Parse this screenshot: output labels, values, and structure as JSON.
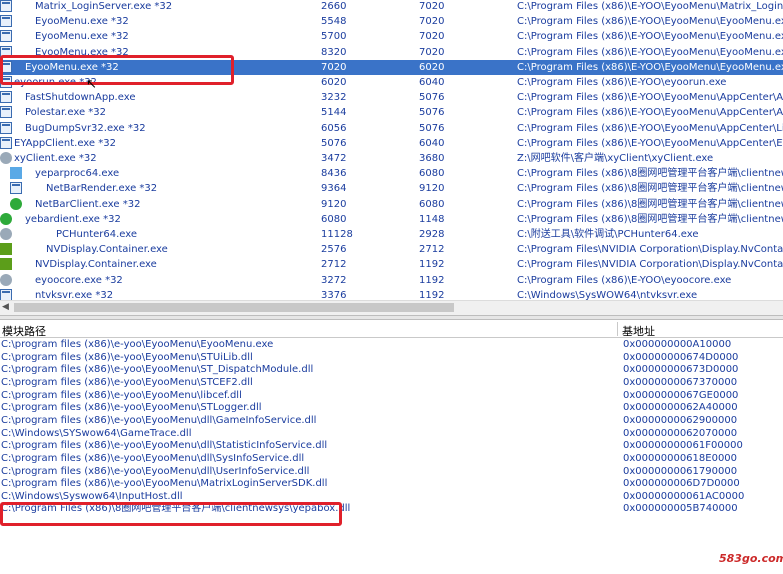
{
  "processes": [
    {
      "name": "Matrix_LoginServer.exe *32",
      "pid": "2660",
      "ppid": "7020",
      "path": "C:\\Program Files (x86)\\E-YOO\\EyooMenu\\Matrix_LoginServer",
      "icon": "window-icon"
    },
    {
      "name": "EyooMenu.exe *32",
      "pid": "5548",
      "ppid": "7020",
      "path": "C:\\Program Files (x86)\\E-YOO\\EyooMenu\\EyooMenu.exe",
      "icon": "window-icon"
    },
    {
      "name": "EyooMenu.exe *32",
      "pid": "5700",
      "ppid": "7020",
      "path": "C:\\Program Files (x86)\\E-YOO\\EyooMenu\\EyooMenu.exe",
      "icon": "window-icon"
    },
    {
      "name": "EyooMenu.exe *32",
      "pid": "8320",
      "ppid": "7020",
      "path": "C:\\Program Files (x86)\\E-YOO\\EyooMenu\\EyooMenu.exe",
      "icon": "window-icon"
    },
    {
      "name": "EyooMenu.exe *32",
      "pid": "7020",
      "ppid": "6020",
      "path": "C:\\Program Files (x86)\\E-YOO\\EyooMenu\\EyooMenu.exe",
      "icon": "window-icon",
      "selected": true
    },
    {
      "name": "eyoorun.exe *32",
      "pid": "6020",
      "ppid": "6040",
      "path": "C:\\Program Files (x86)\\E-YOO\\eyoorun.exe",
      "icon": "window-icon"
    },
    {
      "name": "FastShutdownApp.exe",
      "pid": "3232",
      "ppid": "5076",
      "path": "C:\\Program Files (x86)\\E-YOO\\EyooMenu\\AppCenter\\App\\Fast",
      "icon": "window-icon"
    },
    {
      "name": "Polestar.exe *32",
      "pid": "5144",
      "ppid": "5076",
      "path": "C:\\Program Files (x86)\\E-YOO\\EyooMenu\\AppCenter\\App\\Mo",
      "icon": "window-icon"
    },
    {
      "name": "BugDumpSvr32.exe *32",
      "pid": "6056",
      "ppid": "5076",
      "path": "C:\\Program Files (x86)\\E-YOO\\EyooMenu\\AppCenter\\LiDump\\",
      "icon": "window-icon"
    },
    {
      "name": "EYAppClient.exe *32",
      "pid": "5076",
      "ppid": "6040",
      "path": "C:\\Program Files (x86)\\E-YOO\\EyooMenu\\AppCenter\\EYAppC",
      "icon": "window-icon"
    },
    {
      "name": "xyClient.exe *32",
      "pid": "3472",
      "ppid": "3680",
      "path": "Z:\\网吧软件\\客户端\\xyClient\\xyClient.exe",
      "icon": "gear-icon"
    },
    {
      "name": "yeparproc64.exe",
      "pid": "8436",
      "ppid": "6080",
      "path": "C:\\Program Files (x86)\\8圈网吧管理平台客户端\\clientnewsys",
      "icon": "bolt-icon"
    },
    {
      "name": "NetBarRender.exe *32",
      "pid": "9364",
      "ppid": "9120",
      "path": "C:\\Program Files (x86)\\8圈网吧管理平台客户端\\clientnewsys",
      "icon": "window-icon"
    },
    {
      "name": "NetBarClient.exe *32",
      "pid": "9120",
      "ppid": "6080",
      "path": "C:\\Program Files (x86)\\8圈网吧管理平台客户端\\clientnewsys",
      "icon": "green-circle-icon"
    },
    {
      "name": "yebardient.exe *32",
      "pid": "6080",
      "ppid": "1148",
      "path": "C:\\Program Files (x86)\\8圈网吧管理平台客户端\\clientnewsys",
      "icon": "green-circle-icon"
    },
    {
      "name": "PCHunter64.exe",
      "pid": "11128",
      "ppid": "2928",
      "path": "C:\\附送工具\\软件调试\\PCHunter64.exe",
      "icon": "gear-icon"
    },
    {
      "name": "NVDisplay.Container.exe",
      "pid": "2576",
      "ppid": "2712",
      "path": "C:\\Program Files\\NVIDIA Corporation\\Display.NvContainer\\NV",
      "icon": "nvidia-icon"
    },
    {
      "name": "NVDisplay.Container.exe",
      "pid": "2712",
      "ppid": "1192",
      "path": "C:\\Program Files\\NVIDIA Corporation\\Display.NvContainer\\NV",
      "icon": "nvidia-icon"
    },
    {
      "name": "eyoocore.exe *32",
      "pid": "3272",
      "ppid": "1192",
      "path": "C:\\Program Files (x86)\\E-YOO\\eyoocore.exe",
      "icon": "gear-icon"
    },
    {
      "name": "ntvksvr.exe *32",
      "pid": "3376",
      "ppid": "1192",
      "path": "C:\\Windows\\SysWOW64\\ntvksvr.exe",
      "icon": "window-icon"
    }
  ],
  "modules_header": {
    "path": "模块路径",
    "base": "基地址"
  },
  "modules": [
    {
      "path": "C:\\program files (x86)\\e-yoo\\EyooMenu\\EyooMenu.exe",
      "base": "0x000000000A10000"
    },
    {
      "path": "C:\\program files (x86)\\e-yoo\\EyooMenu\\STUiLib.dll",
      "base": "0x00000000674D0000"
    },
    {
      "path": "C:\\program files (x86)\\e-yoo\\EyooMenu\\ST_DispatchModule.dll",
      "base": "0x00000000673D0000"
    },
    {
      "path": "C:\\program files (x86)\\e-yoo\\EyooMenu\\STCEF2.dll",
      "base": "0x0000000067370000"
    },
    {
      "path": "C:\\program files (x86)\\e-yoo\\EyooMenu\\libcef.dll",
      "base": "0x0000000067GE0000"
    },
    {
      "path": "C:\\program files (x86)\\e-yoo\\EyooMenu\\STLogger.dll",
      "base": "0x0000000062A40000"
    },
    {
      "path": "C:\\program files (x86)\\e-yoo\\EyooMenu\\dll\\GameInfoService.dll",
      "base": "0x0000000062900000"
    },
    {
      "path": "C:\\Windows\\SYSwow64\\GameTrace.dll",
      "base": "0x0000000062070000"
    },
    {
      "path": "C:\\program files (x86)\\e-yoo\\EyooMenu\\dll\\StatisticInfoService.dll",
      "base": "0x00000000061F00000"
    },
    {
      "path": "C:\\program files (x86)\\e-yoo\\EyooMenu\\dll\\SysInfoService.dll",
      "base": "0x00000000618E0000"
    },
    {
      "path": "C:\\program files (x86)\\e-yoo\\EyooMenu\\dll\\UserInfoService.dll",
      "base": "0x0000000061790000"
    },
    {
      "path": "C:\\program files (x86)\\e-yoo\\EyooMenu\\MatrixLoginServerSDK.dll",
      "base": "0x000000006D7D0000"
    },
    {
      "path": "C:\\Windows\\Syswow64\\InputHost.dll",
      "base": "0x00000000061AC0000"
    },
    {
      "path": "C:\\Program Files (x86)\\8圈网吧管理平台客户端\\clientnewsys\\yepabox.dll",
      "base": "0x000000005B740000"
    }
  ],
  "watermark": "583go.com"
}
